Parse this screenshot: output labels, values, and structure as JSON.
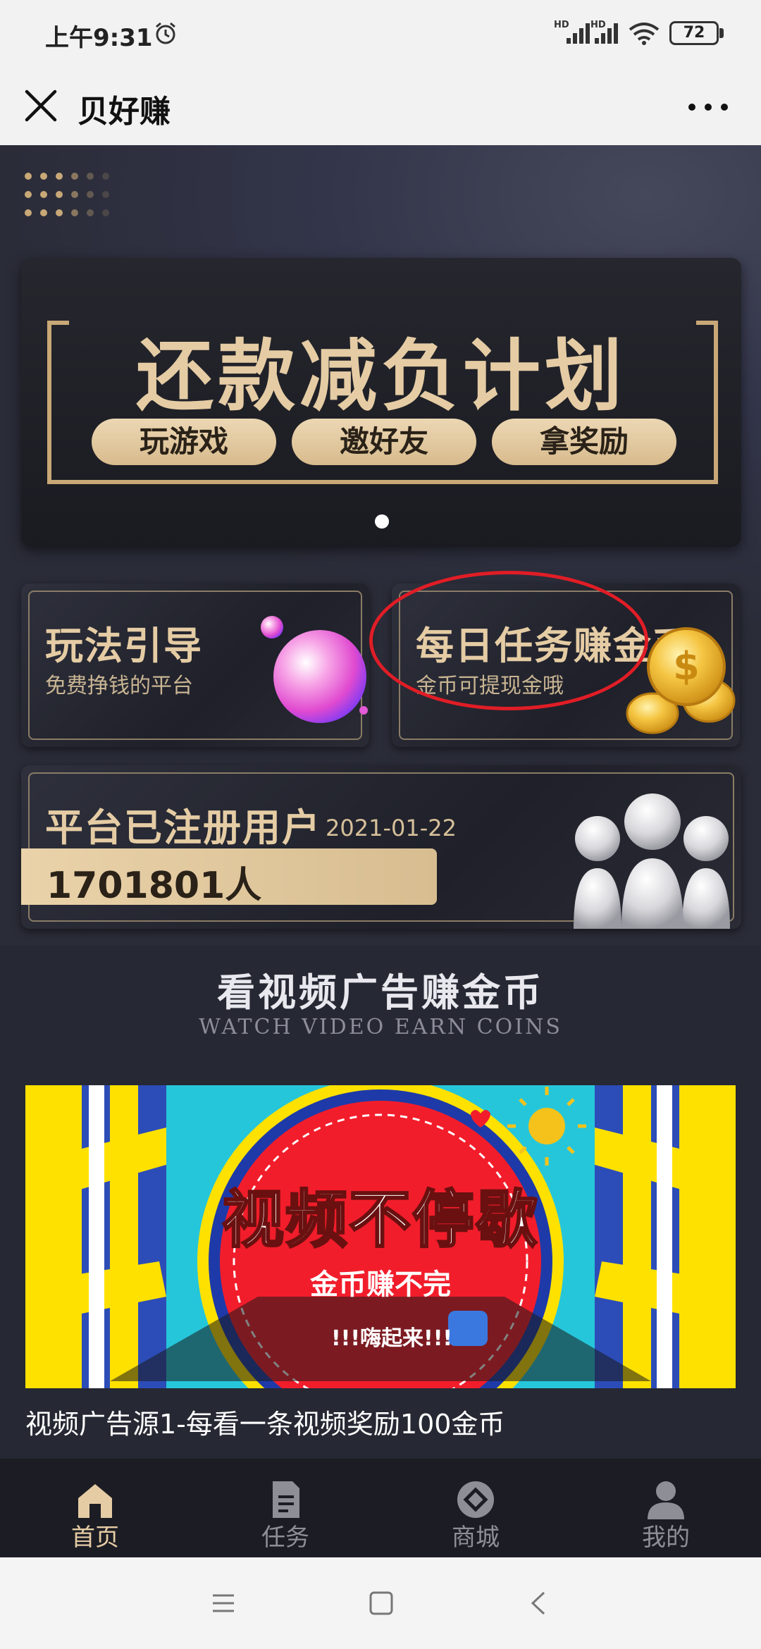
{
  "status_bar": {
    "time": "上午9:31",
    "signal_1_label": "HD",
    "signal_2_label": "HD",
    "battery": "72"
  },
  "title_bar": {
    "title": "贝好赚"
  },
  "banner": {
    "title": "还款减负计划",
    "pills": [
      "玩游戏",
      "邀好友",
      "拿奖励"
    ],
    "accent": "#e5cca4"
  },
  "cards": {
    "guide": {
      "title": "玩法引导",
      "subtitle": "免费挣钱的平台"
    },
    "daily": {
      "title": "每日任务赚金币",
      "subtitle": "金币可提现金哦"
    }
  },
  "users": {
    "label": "平台已注册用户",
    "date": "2021-01-22",
    "count": "1701801人"
  },
  "video_section": {
    "title": "看视频广告赚金币",
    "subtitle": "WATCH VIDEO  EARN COINS",
    "banner_title": "视频不停歇",
    "banner_sub": "金币赚不完",
    "banner_sub2": "!!!嗨起来!!!",
    "caption": "视频广告源1-每看一条视频奖励100金币"
  },
  "bottom_nav": {
    "items": [
      {
        "label": "首页",
        "icon": "home-icon",
        "active": true
      },
      {
        "label": "任务",
        "icon": "document-icon",
        "active": false
      },
      {
        "label": "商城",
        "icon": "shop-icon",
        "active": false
      },
      {
        "label": "我的",
        "icon": "user-icon",
        "active": false
      }
    ],
    "active_color": "#e5cca4",
    "inactive_color": "#8e8e96"
  }
}
